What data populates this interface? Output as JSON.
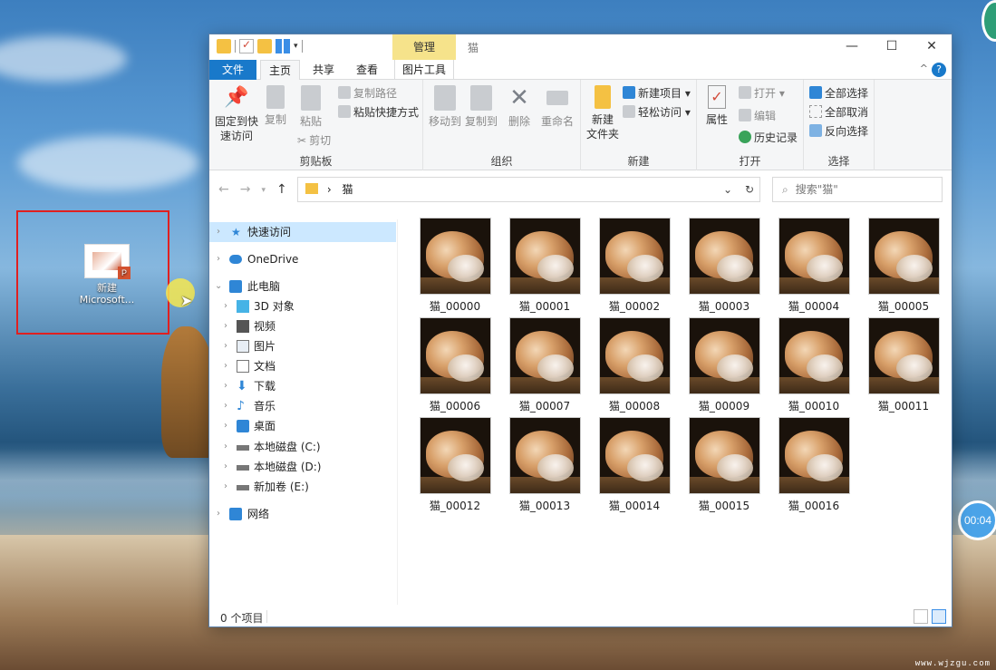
{
  "desktop": {
    "icon_label_line1": "新建",
    "icon_label_line2": "Microsoft...",
    "icon_badge": "P",
    "timer": "00:04",
    "watermark": "www.wjzgu.com"
  },
  "window": {
    "contextual_tab": "管理",
    "title": "猫",
    "controls": {
      "minimize": "—",
      "maximize": "☐",
      "close": "✕"
    },
    "tabs": [
      {
        "label": "文件"
      },
      {
        "label": "主页"
      },
      {
        "label": "共享"
      },
      {
        "label": "查看"
      },
      {
        "label": "图片工具"
      }
    ],
    "help": "?"
  },
  "ribbon": {
    "clipboard": {
      "label": "剪贴板",
      "pin": "固定到快速访问",
      "pin_l1": "固定到快",
      "pin_l2": "速访问",
      "copy": "复制",
      "paste": "粘贴",
      "copy_path": "复制路径",
      "paste_shortcut": "粘贴快捷方式",
      "cut": "剪切"
    },
    "organize": {
      "label": "组织",
      "move_to": "移动到",
      "copy_to": "复制到",
      "delete": "删除",
      "rename": "重命名"
    },
    "new": {
      "label": "新建",
      "new_folder_l1": "新建",
      "new_folder_l2": "文件夹",
      "new_item": "新建项目 ▾",
      "easy_access": "轻松访问 ▾"
    },
    "open": {
      "label": "打开",
      "properties": "属性",
      "open": "打开 ▾",
      "edit": "编辑",
      "history": "历史记录"
    },
    "select": {
      "label": "选择",
      "select_all": "全部选择",
      "select_none": "全部取消",
      "invert": "反向选择"
    }
  },
  "address": {
    "path": "猫",
    "search_placeholder": "搜索\"猫\""
  },
  "nav": {
    "items": [
      {
        "label": "快速访问"
      },
      {
        "label": "OneDrive"
      },
      {
        "label": "此电脑"
      },
      {
        "label": "3D 对象"
      },
      {
        "label": "视频"
      },
      {
        "label": "图片"
      },
      {
        "label": "文档"
      },
      {
        "label": "下载"
      },
      {
        "label": "音乐"
      },
      {
        "label": "桌面"
      },
      {
        "label": "本地磁盘 (C:)"
      },
      {
        "label": "本地磁盘 (D:)"
      },
      {
        "label": "新加卷 (E:)"
      },
      {
        "label": "网络"
      }
    ]
  },
  "files": [
    "猫_00000",
    "猫_00001",
    "猫_00002",
    "猫_00003",
    "猫_00004",
    "猫_00005",
    "猫_00006",
    "猫_00007",
    "猫_00008",
    "猫_00009",
    "猫_00010",
    "猫_00011",
    "猫_00012",
    "猫_00013",
    "猫_00014",
    "猫_00015",
    "猫_00016"
  ],
  "status": {
    "count": "0 个项目"
  },
  "colors": {
    "accent": "#1979ca",
    "contextual_tab": "#f6e38b",
    "selection_border": "#e02020"
  }
}
